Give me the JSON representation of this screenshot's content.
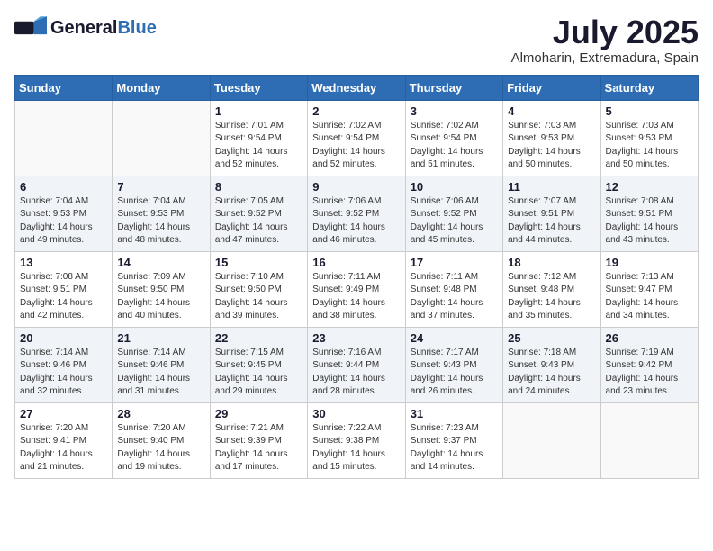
{
  "header": {
    "logo_general": "General",
    "logo_blue": "Blue",
    "month_year": "July 2025",
    "location": "Almoharin, Extremadura, Spain"
  },
  "days_of_week": [
    "Sunday",
    "Monday",
    "Tuesday",
    "Wednesday",
    "Thursday",
    "Friday",
    "Saturday"
  ],
  "weeks": [
    [
      {
        "day": "",
        "sunrise": "",
        "sunset": "",
        "daylight": ""
      },
      {
        "day": "",
        "sunrise": "",
        "sunset": "",
        "daylight": ""
      },
      {
        "day": "1",
        "sunrise": "Sunrise: 7:01 AM",
        "sunset": "Sunset: 9:54 PM",
        "daylight": "Daylight: 14 hours and 52 minutes."
      },
      {
        "day": "2",
        "sunrise": "Sunrise: 7:02 AM",
        "sunset": "Sunset: 9:54 PM",
        "daylight": "Daylight: 14 hours and 52 minutes."
      },
      {
        "day": "3",
        "sunrise": "Sunrise: 7:02 AM",
        "sunset": "Sunset: 9:54 PM",
        "daylight": "Daylight: 14 hours and 51 minutes."
      },
      {
        "day": "4",
        "sunrise": "Sunrise: 7:03 AM",
        "sunset": "Sunset: 9:53 PM",
        "daylight": "Daylight: 14 hours and 50 minutes."
      },
      {
        "day": "5",
        "sunrise": "Sunrise: 7:03 AM",
        "sunset": "Sunset: 9:53 PM",
        "daylight": "Daylight: 14 hours and 50 minutes."
      }
    ],
    [
      {
        "day": "6",
        "sunrise": "Sunrise: 7:04 AM",
        "sunset": "Sunset: 9:53 PM",
        "daylight": "Daylight: 14 hours and 49 minutes."
      },
      {
        "day": "7",
        "sunrise": "Sunrise: 7:04 AM",
        "sunset": "Sunset: 9:53 PM",
        "daylight": "Daylight: 14 hours and 48 minutes."
      },
      {
        "day": "8",
        "sunrise": "Sunrise: 7:05 AM",
        "sunset": "Sunset: 9:52 PM",
        "daylight": "Daylight: 14 hours and 47 minutes."
      },
      {
        "day": "9",
        "sunrise": "Sunrise: 7:06 AM",
        "sunset": "Sunset: 9:52 PM",
        "daylight": "Daylight: 14 hours and 46 minutes."
      },
      {
        "day": "10",
        "sunrise": "Sunrise: 7:06 AM",
        "sunset": "Sunset: 9:52 PM",
        "daylight": "Daylight: 14 hours and 45 minutes."
      },
      {
        "day": "11",
        "sunrise": "Sunrise: 7:07 AM",
        "sunset": "Sunset: 9:51 PM",
        "daylight": "Daylight: 14 hours and 44 minutes."
      },
      {
        "day": "12",
        "sunrise": "Sunrise: 7:08 AM",
        "sunset": "Sunset: 9:51 PM",
        "daylight": "Daylight: 14 hours and 43 minutes."
      }
    ],
    [
      {
        "day": "13",
        "sunrise": "Sunrise: 7:08 AM",
        "sunset": "Sunset: 9:51 PM",
        "daylight": "Daylight: 14 hours and 42 minutes."
      },
      {
        "day": "14",
        "sunrise": "Sunrise: 7:09 AM",
        "sunset": "Sunset: 9:50 PM",
        "daylight": "Daylight: 14 hours and 40 minutes."
      },
      {
        "day": "15",
        "sunrise": "Sunrise: 7:10 AM",
        "sunset": "Sunset: 9:50 PM",
        "daylight": "Daylight: 14 hours and 39 minutes."
      },
      {
        "day": "16",
        "sunrise": "Sunrise: 7:11 AM",
        "sunset": "Sunset: 9:49 PM",
        "daylight": "Daylight: 14 hours and 38 minutes."
      },
      {
        "day": "17",
        "sunrise": "Sunrise: 7:11 AM",
        "sunset": "Sunset: 9:48 PM",
        "daylight": "Daylight: 14 hours and 37 minutes."
      },
      {
        "day": "18",
        "sunrise": "Sunrise: 7:12 AM",
        "sunset": "Sunset: 9:48 PM",
        "daylight": "Daylight: 14 hours and 35 minutes."
      },
      {
        "day": "19",
        "sunrise": "Sunrise: 7:13 AM",
        "sunset": "Sunset: 9:47 PM",
        "daylight": "Daylight: 14 hours and 34 minutes."
      }
    ],
    [
      {
        "day": "20",
        "sunrise": "Sunrise: 7:14 AM",
        "sunset": "Sunset: 9:46 PM",
        "daylight": "Daylight: 14 hours and 32 minutes."
      },
      {
        "day": "21",
        "sunrise": "Sunrise: 7:14 AM",
        "sunset": "Sunset: 9:46 PM",
        "daylight": "Daylight: 14 hours and 31 minutes."
      },
      {
        "day": "22",
        "sunrise": "Sunrise: 7:15 AM",
        "sunset": "Sunset: 9:45 PM",
        "daylight": "Daylight: 14 hours and 29 minutes."
      },
      {
        "day": "23",
        "sunrise": "Sunrise: 7:16 AM",
        "sunset": "Sunset: 9:44 PM",
        "daylight": "Daylight: 14 hours and 28 minutes."
      },
      {
        "day": "24",
        "sunrise": "Sunrise: 7:17 AM",
        "sunset": "Sunset: 9:43 PM",
        "daylight": "Daylight: 14 hours and 26 minutes."
      },
      {
        "day": "25",
        "sunrise": "Sunrise: 7:18 AM",
        "sunset": "Sunset: 9:43 PM",
        "daylight": "Daylight: 14 hours and 24 minutes."
      },
      {
        "day": "26",
        "sunrise": "Sunrise: 7:19 AM",
        "sunset": "Sunset: 9:42 PM",
        "daylight": "Daylight: 14 hours and 23 minutes."
      }
    ],
    [
      {
        "day": "27",
        "sunrise": "Sunrise: 7:20 AM",
        "sunset": "Sunset: 9:41 PM",
        "daylight": "Daylight: 14 hours and 21 minutes."
      },
      {
        "day": "28",
        "sunrise": "Sunrise: 7:20 AM",
        "sunset": "Sunset: 9:40 PM",
        "daylight": "Daylight: 14 hours and 19 minutes."
      },
      {
        "day": "29",
        "sunrise": "Sunrise: 7:21 AM",
        "sunset": "Sunset: 9:39 PM",
        "daylight": "Daylight: 14 hours and 17 minutes."
      },
      {
        "day": "30",
        "sunrise": "Sunrise: 7:22 AM",
        "sunset": "Sunset: 9:38 PM",
        "daylight": "Daylight: 14 hours and 15 minutes."
      },
      {
        "day": "31",
        "sunrise": "Sunrise: 7:23 AM",
        "sunset": "Sunset: 9:37 PM",
        "daylight": "Daylight: 14 hours and 14 minutes."
      },
      {
        "day": "",
        "sunrise": "",
        "sunset": "",
        "daylight": ""
      },
      {
        "day": "",
        "sunrise": "",
        "sunset": "",
        "daylight": ""
      }
    ]
  ]
}
